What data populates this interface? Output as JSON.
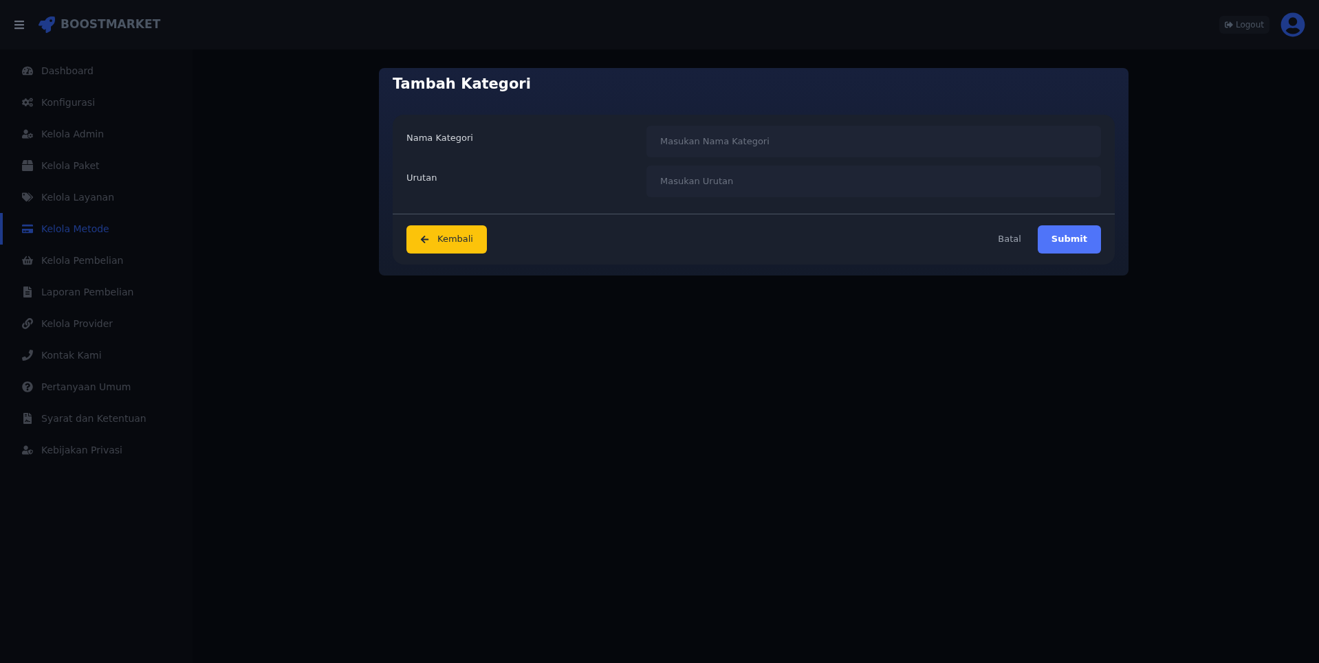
{
  "header": {
    "brand": "BOOSTMARKET",
    "logout": "Logout"
  },
  "sidebar": {
    "items": [
      {
        "label": "Dashboard",
        "selected": false
      },
      {
        "label": "Konfigurasi",
        "selected": false
      },
      {
        "label": "Kelola Admin",
        "selected": false
      },
      {
        "label": "Kelola Paket",
        "selected": false
      },
      {
        "label": "Kelola Layanan",
        "selected": false
      },
      {
        "label": "Kelola Metode",
        "selected": true
      },
      {
        "label": "Kelola Pembelian",
        "selected": false
      },
      {
        "label": "Laporan Pembelian",
        "selected": false
      },
      {
        "label": "Kelola Provider",
        "selected": false
      },
      {
        "label": "Kontak Kami",
        "selected": false
      },
      {
        "label": "Pertanyaan Umum",
        "selected": false
      },
      {
        "label": "Syarat dan Ketentuan",
        "selected": false
      },
      {
        "label": "Kebijakan Privasi",
        "selected": false
      }
    ]
  },
  "form": {
    "title": "Tambah Kategori",
    "fields": [
      {
        "label": "Nama Kategori",
        "placeholder": "Masukan Nama Kategori"
      },
      {
        "label": "Urutan",
        "placeholder": "Masukan Urutan"
      }
    ],
    "back": "Kembali",
    "cancel": "Batal",
    "submit": "Submit"
  }
}
